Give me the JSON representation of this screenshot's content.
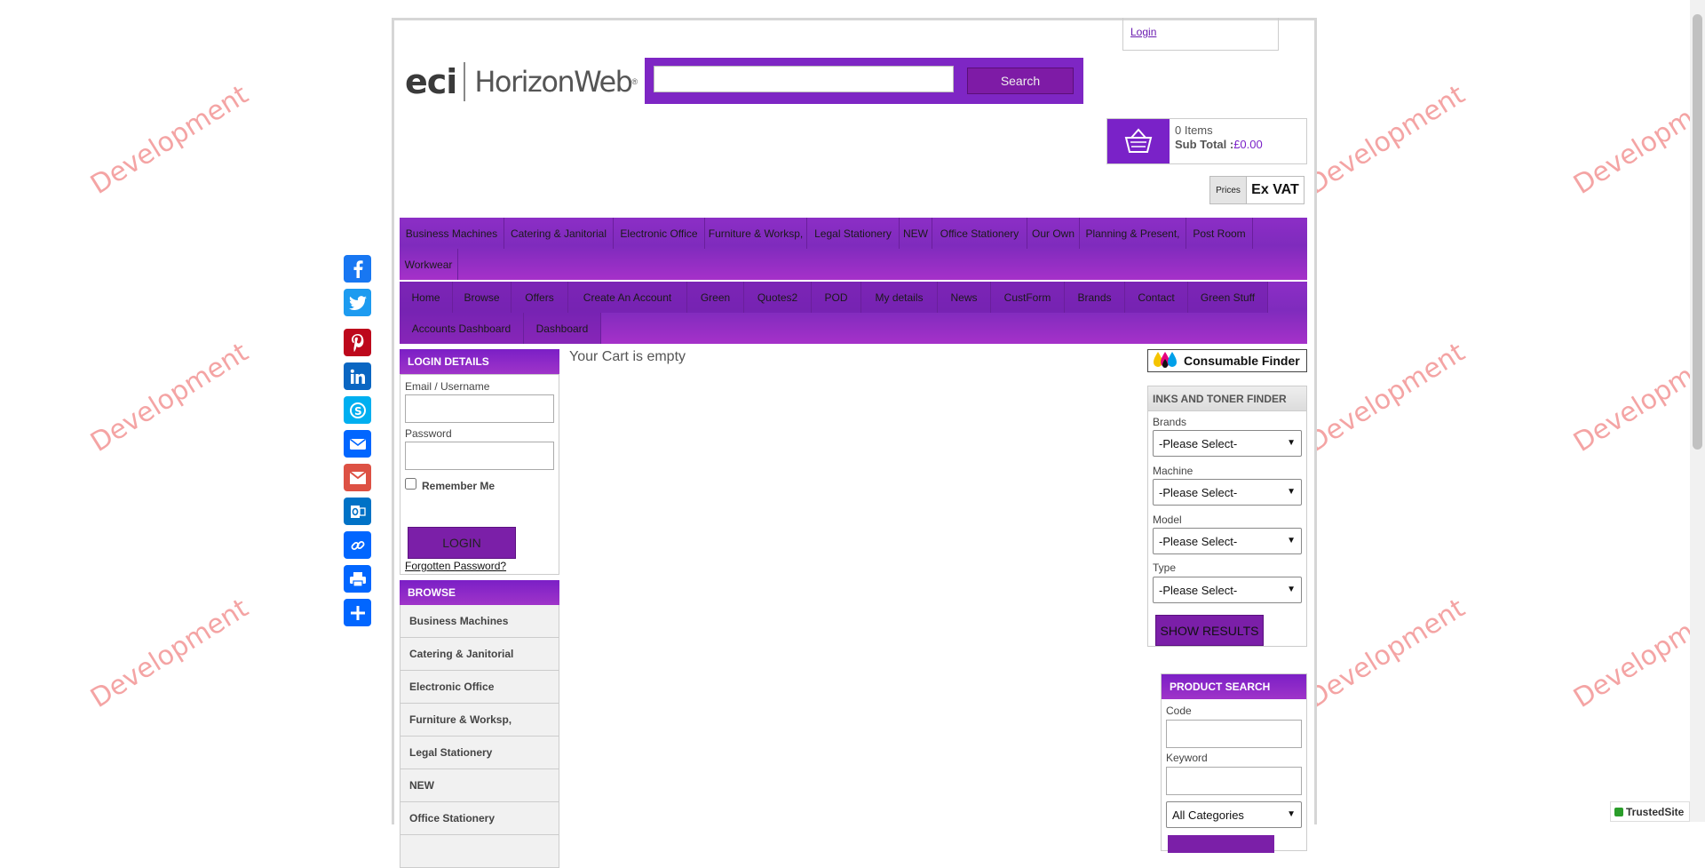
{
  "watermark": "Development",
  "header": {
    "logo_eci": "eci",
    "logo_product": "HorizonWeb",
    "logo_reg": "®",
    "search_button": "Search",
    "login_link": "Login"
  },
  "cart": {
    "items": "0 Items",
    "subtotal_label": "Sub Total :",
    "subtotal_value": "£0.00"
  },
  "vat": {
    "prices": "Prices",
    "mode": "Ex VAT"
  },
  "nav1": [
    "Business Machines",
    "Catering & Janitorial",
    "Electronic Office",
    "Furniture & Worksp,",
    "Legal Stationery",
    "NEW",
    "Office Stationery",
    "Our Own",
    "Planning & Present,",
    "Post Room",
    "Workwear"
  ],
  "nav2": [
    "Home",
    "Browse",
    "Offers",
    "Create An Account",
    "Green",
    "Quotes2",
    "POD",
    "My details",
    "News",
    "CustForm",
    "Brands",
    "Contact",
    "Green Stuff",
    "Accounts Dashboard",
    "Dashboard"
  ],
  "login_panel": {
    "title": "LOGIN DETAILS",
    "email_label": "Email / Username",
    "password_label": "Password",
    "remember": "Remember Me",
    "login_button": "LOGIN",
    "forgot": "Forgotten Password?"
  },
  "browse": {
    "title": "BROWSE",
    "items": [
      "Business Machines",
      "Catering & Janitorial",
      "Electronic Office",
      "Furniture & Worksp,",
      "Legal Stationery",
      "NEW",
      "Office Stationery"
    ]
  },
  "main": {
    "empty_message": "Your Cart is empty"
  },
  "consumable_finder": "Consumable Finder",
  "finder": {
    "title": "INKS AND TONER FINDER",
    "brands": "Brands",
    "machine": "Machine",
    "model": "Model",
    "type": "Type",
    "please_select": "-Please Select-",
    "show_results": "SHOW RESULTS"
  },
  "product_search": {
    "title": "PRODUCT SEARCH",
    "code": "Code",
    "keyword": "Keyword",
    "category": "All Categories"
  },
  "trusted": "TrustedSite",
  "colors": {
    "brand_purple": "#7b1fc6",
    "facebook": "#1877f2"
  }
}
